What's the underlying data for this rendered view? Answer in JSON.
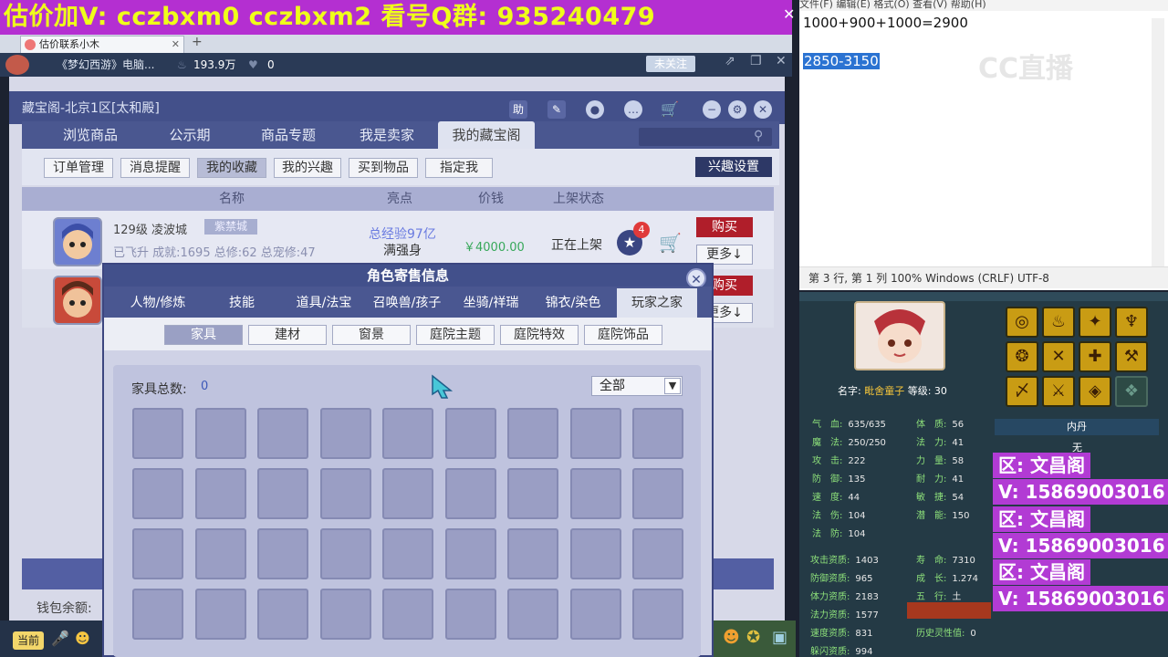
{
  "banner": {
    "text": "估价加V:  cczbxm0   cczbxm2   看号Q群: 935240479",
    "close": "✕"
  },
  "browser": {
    "tab_label": "估价联系小木",
    "tab_close": "✕",
    "tab_plus": "+"
  },
  "stream": {
    "title": "《梦幻西游》电脑...",
    "hot": "193.9万",
    "likes": "0",
    "follow": "未关注"
  },
  "game": {
    "window_title": "藏宝阁-北京1区[太和殿]",
    "help": "助",
    "tabs": [
      "浏览商品",
      "公示期",
      "商品专题",
      "我是卖家",
      "我的藏宝阁"
    ],
    "subtabs": [
      "订单管理",
      "消息提醒",
      "我的收藏",
      "我的兴趣",
      "买到物品",
      "指定我"
    ],
    "interest_settings": "兴趣设置",
    "columns": [
      "名称",
      "亮点",
      "价钱",
      "上架状态"
    ],
    "row1": {
      "level_server": "129级  凌波城",
      "badge": "紫禁城",
      "stats": "已飞升 成就:1695 总修:62 总宠修:47",
      "highlight1": "总经验97亿",
      "highlight2": "满强身",
      "price": "￥4000.00",
      "status": "正在上架",
      "star_count": "4",
      "buy": "购买",
      "more": "更多↓"
    },
    "row2": {
      "buy": "购买",
      "more": "更多↓"
    },
    "wallet": "钱包余额:"
  },
  "modal": {
    "title": "角色寄售信息",
    "tabs": [
      "人物/修炼",
      "技能",
      "道具/法宝",
      "召唤兽/孩子",
      "坐骑/祥瑞",
      "锦衣/染色",
      "玩家之家"
    ],
    "filters": [
      "家具",
      "建材",
      "窗景",
      "庭院主题",
      "庭院特效",
      "庭院饰品"
    ],
    "total_label": "家具总数:",
    "total_value": "0",
    "dropdown": "全部"
  },
  "bottom": {
    "channel": "当前"
  },
  "notepad": {
    "menu": "文件(F)   编辑(E)   格式(O)   查看(V)   帮助(H)",
    "line1": "1000+900+1000=2900",
    "line2": "2850-3150",
    "status": "第 3 行, 第 1 列    100%     Windows (CRLF)      UTF-8",
    "logo": "CC直播"
  },
  "char": {
    "name_label": "名字: ",
    "name": "毗舍童子",
    "level_label": "  等级: 30",
    "neidan": "内丹",
    "neidan_value": "无",
    "attrs": [
      {
        "k": "气　血:",
        "v": "635/635"
      },
      {
        "k": "魔　法:",
        "v": "250/250"
      },
      {
        "k": "攻　击:",
        "v": "222"
      },
      {
        "k": "防　御:",
        "v": "135"
      },
      {
        "k": "速　度:",
        "v": "44"
      },
      {
        "k": "法　伤:",
        "v": "104"
      },
      {
        "k": "法　防:",
        "v": "104"
      }
    ],
    "attrs2": [
      {
        "k": "体　质:",
        "v": "56"
      },
      {
        "k": "法　力:",
        "v": "41"
      },
      {
        "k": "力　量:",
        "v": "58"
      },
      {
        "k": "耐　力:",
        "v": "41"
      },
      {
        "k": "敏　捷:",
        "v": "54"
      },
      {
        "k": "潜　能:",
        "v": "150"
      }
    ],
    "apt": [
      {
        "k": "攻击资质:",
        "v": "1403"
      },
      {
        "k": "防御资质:",
        "v": "965"
      },
      {
        "k": "体力资质:",
        "v": "2183"
      },
      {
        "k": "法力资质:",
        "v": "1577"
      },
      {
        "k": "速度资质:",
        "v": "831"
      },
      {
        "k": "躲闪资质:",
        "v": "994"
      }
    ],
    "apt2": [
      {
        "k": "寿　命:",
        "v": "7310"
      },
      {
        "k": "成　长:",
        "v": "1.274"
      },
      {
        "k": "五　行:",
        "v": "土"
      },
      {
        "k": "是否宝宝:",
        "v": "是"
      },
      {
        "k": "历史灵性值:",
        "v": "0"
      }
    ]
  },
  "watermark": {
    "area": "区: 文昌阁",
    "phone": "V: 15869003016"
  }
}
